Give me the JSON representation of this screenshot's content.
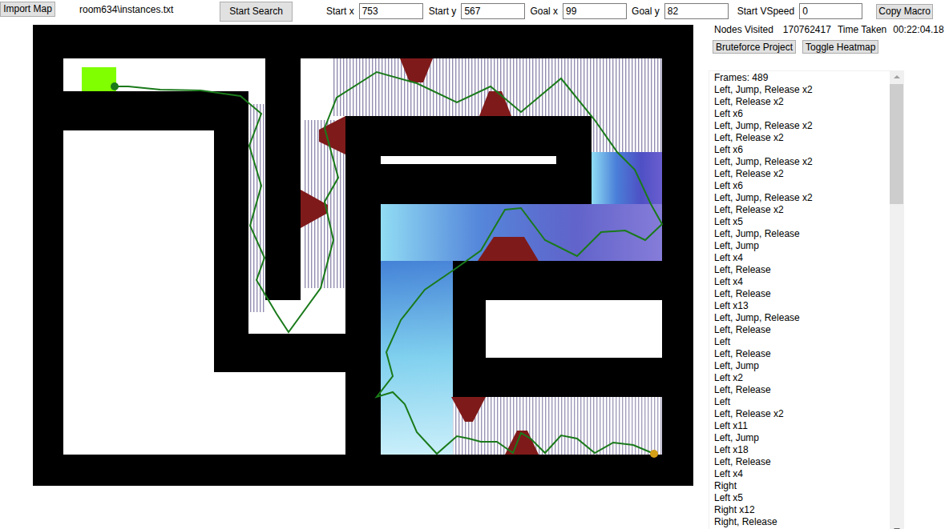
{
  "toolbar": {
    "import_button": "Import Map",
    "map_file": "room634\\instances.txt",
    "search_button": "Start Search",
    "fields": [
      {
        "label": "Start x",
        "value": "753"
      },
      {
        "label": "Start y",
        "value": "567"
      },
      {
        "label": "Goal x",
        "value": "99"
      },
      {
        "label": "Goal y",
        "value": "82"
      },
      {
        "label": "Start VSpeed",
        "value": "0"
      }
    ],
    "copy_button": "Copy Macro"
  },
  "stats": {
    "nodes_label": "Nodes Visited",
    "nodes": "170762417",
    "time_label": "Time Taken",
    "time": "00:22:04.18"
  },
  "side_buttons": [
    "Bruteforce Project",
    "Toggle Heatmap"
  ],
  "heatmap_visible": true,
  "macro": {
    "frames": "Frames: 489",
    "lines": [
      "Left, Jump, Release x2",
      "Left, Release x2",
      "Left x6",
      "Left, Jump, Release x2",
      "Left, Release x2",
      "Left x6",
      "Left, Jump, Release x2",
      "Left, Release x2",
      "Left x6",
      "Left, Jump, Release x2",
      "Left, Release x2",
      "Left x5",
      "Left, Jump, Release",
      "Left, Jump",
      "Left x4",
      "Left, Release",
      "Left x4",
      "Left, Release",
      "Left x13",
      "Left, Jump, Release",
      "Left, Release",
      "Left",
      "Left, Release",
      "Left, Jump",
      "Left x2",
      "Left, Release",
      "Left",
      "Left, Release x2",
      "Left x11",
      "Left, Jump",
      "Left x18",
      "Left, Release",
      "Left x4",
      "Right",
      "Left x5",
      "Right x12",
      "Right, Release"
    ]
  }
}
